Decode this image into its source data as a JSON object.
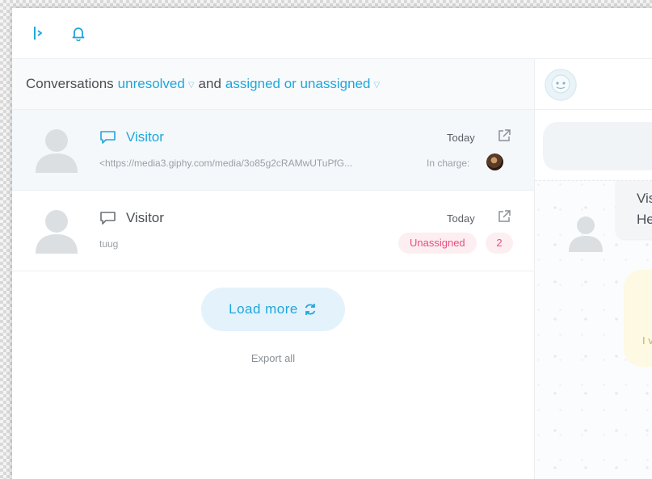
{
  "filter": {
    "prefix": "Conversations",
    "status": "unresolved",
    "joiner": "and",
    "assignment": "assigned or unassigned"
  },
  "conversations": [
    {
      "name": "Visitor",
      "date": "Today",
      "preview": "<https://media3.giphy.com/media/3o85g2cRAMwUTuPfG...",
      "in_charge_label": "In charge:",
      "unread": true
    },
    {
      "name": "Visitor",
      "date": "Today",
      "preview": "tuug",
      "status_badge": "Unassigned",
      "count": "2",
      "unread": false
    }
  ],
  "actions": {
    "load_more": "Load more",
    "export_all": "Export all"
  },
  "chat_preview": {
    "line1": "Vis",
    "line2": "He",
    "line3": "I v"
  },
  "colors": {
    "accent": "#1ea7dc",
    "badge_text": "#e6507e",
    "badge_bg": "#fdeef2"
  },
  "icons": {
    "sidebar_toggle": "sidebar-toggle-icon",
    "notifications": "bell-icon",
    "message": "chat-bubble-icon",
    "open_external": "external-link-icon",
    "refresh": "refresh-icon"
  }
}
